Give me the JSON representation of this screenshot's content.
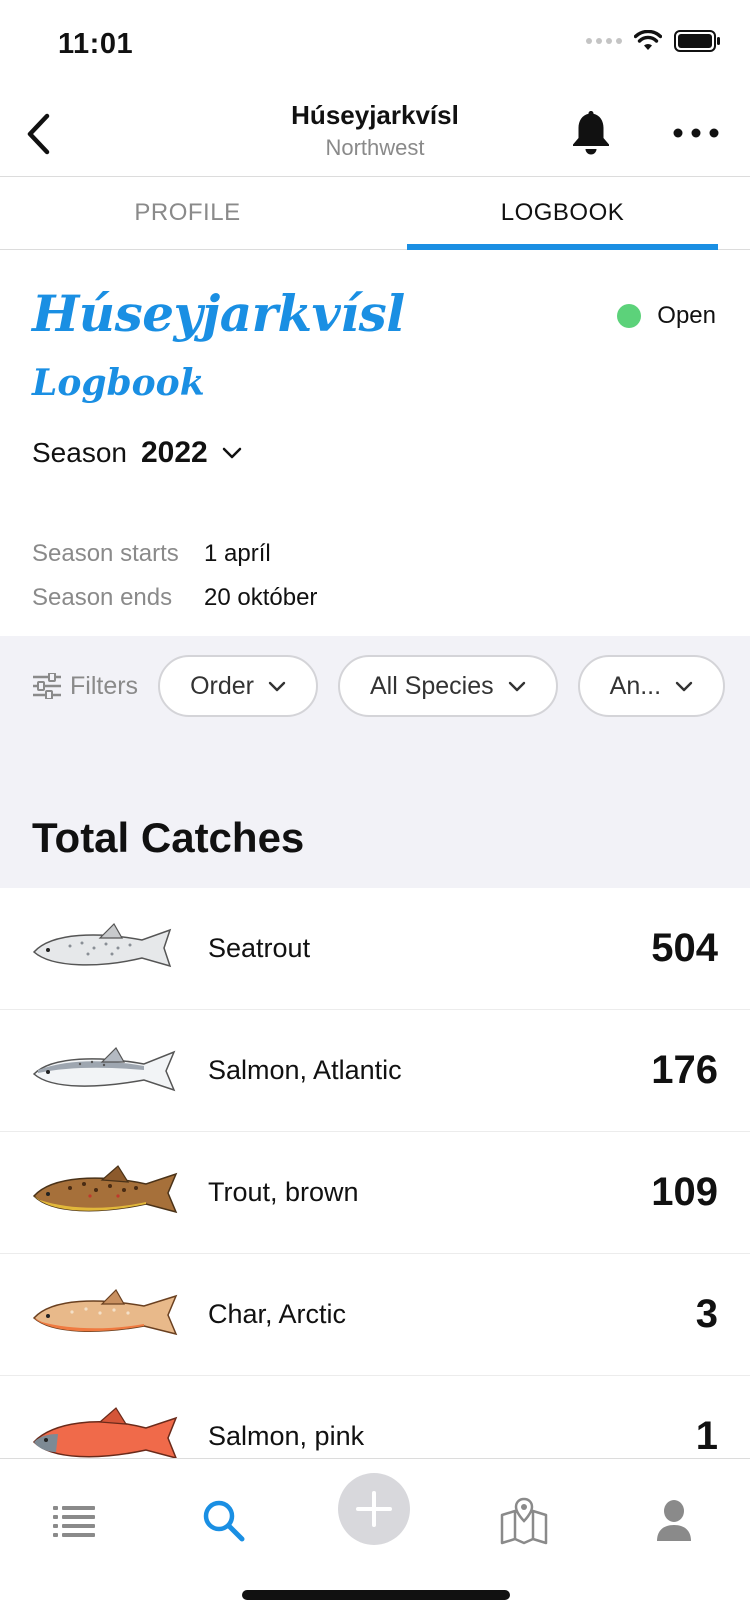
{
  "status_bar": {
    "time": "11:01"
  },
  "header": {
    "title": "Húseyjarkvísl",
    "subtitle": "Northwest"
  },
  "tabs": [
    {
      "label": "PROFILE",
      "active": false
    },
    {
      "label": "LOGBOOK",
      "active": true
    }
  ],
  "hero": {
    "title": "Húseyjarkvísl",
    "subtitle": "Logbook",
    "status": "Open",
    "status_color": "#5cd27a",
    "season_label": "Season",
    "season_value": "2022",
    "season_starts_label": "Season starts",
    "season_starts": "1 apríl",
    "season_ends_label": "Season ends",
    "season_ends": "20 október"
  },
  "filters": {
    "label": "Filters",
    "pills": [
      "Order",
      "All Species",
      "An..."
    ]
  },
  "section_title": "Total Catches",
  "catches": [
    {
      "name": "Seatrout",
      "count": "504",
      "icon": "seatrout-fish"
    },
    {
      "name": "Salmon, Atlantic",
      "count": "176",
      "icon": "atlantic-salmon-fish"
    },
    {
      "name": "Trout, brown",
      "count": "109",
      "icon": "brown-trout-fish"
    },
    {
      "name": "Char, Arctic",
      "count": "3",
      "icon": "arctic-char-fish"
    },
    {
      "name": "Salmon, pink",
      "count": "1",
      "icon": "pink-salmon-fish"
    }
  ],
  "bottom_nav": [
    "list-icon",
    "search-icon",
    "add-icon",
    "map-icon",
    "profile-icon"
  ],
  "colors": {
    "accent": "#1a8fe3",
    "open": "#5cd27a",
    "gray_bg": "#f2f2f7"
  }
}
